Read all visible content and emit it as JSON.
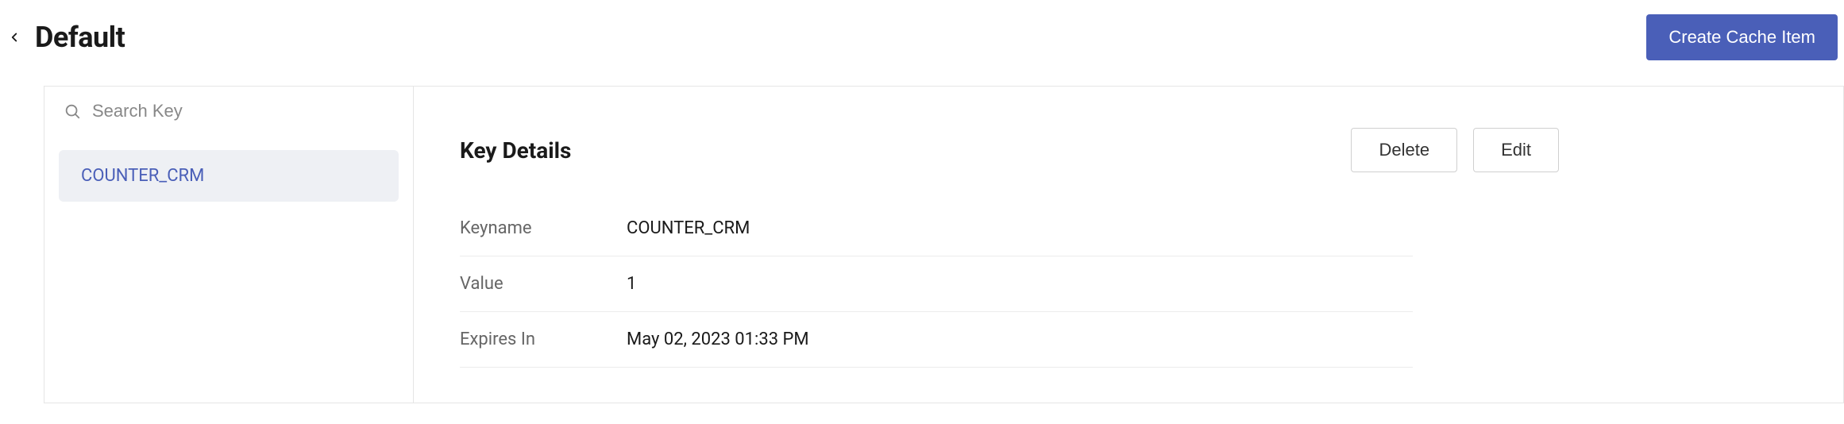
{
  "header": {
    "title": "Default",
    "create_button": "Create Cache Item"
  },
  "sidebar": {
    "search_placeholder": "Search Key",
    "items": [
      {
        "label": "COUNTER_CRM"
      }
    ]
  },
  "details": {
    "heading": "Key Details",
    "delete_button": "Delete",
    "edit_button": "Edit",
    "fields": {
      "keyname_label": "Keyname",
      "keyname_value": "COUNTER_CRM",
      "value_label": "Value",
      "value_value": "1",
      "expires_label": "Expires In",
      "expires_value": "May 02, 2023 01:33 PM"
    }
  }
}
